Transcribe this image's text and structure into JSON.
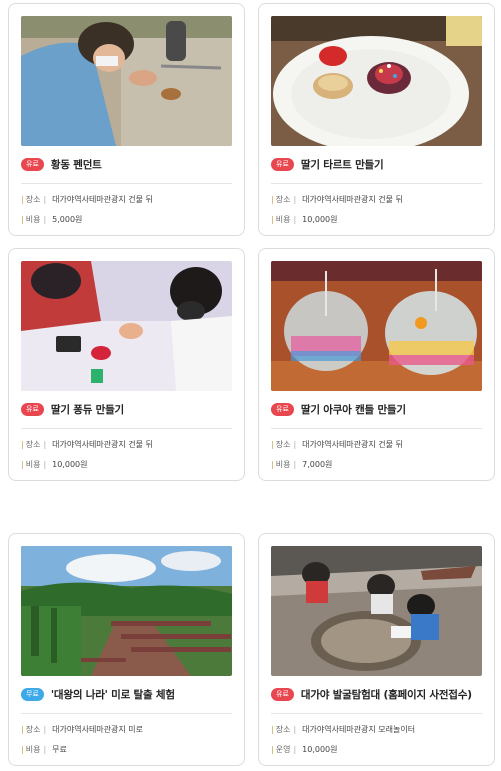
{
  "programs": [
    {
      "badge": "유료",
      "badge_type": "paid",
      "title": "황동 펜던트",
      "info": [
        {
          "label": "장소",
          "value": "대가야역사테마관광지 건물 뒤"
        },
        {
          "label": "비용",
          "value": "5,000원"
        }
      ]
    },
    {
      "badge": "유료",
      "badge_type": "paid",
      "title": "딸기 타르트 만들기",
      "info": [
        {
          "label": "장소",
          "value": "대가야역사테마관광지 건물 뒤"
        },
        {
          "label": "비용",
          "value": "10,000원"
        }
      ]
    },
    {
      "badge": "유료",
      "badge_type": "paid",
      "title": "딸기 퐁듀 만들기",
      "info": [
        {
          "label": "장소",
          "value": "대가야역사테마관광지 건물 뒤"
        },
        {
          "label": "비용",
          "value": "10,000원"
        }
      ]
    },
    {
      "badge": "유료",
      "badge_type": "paid",
      "title": "딸기 아쿠아 캔들 만들기",
      "info": [
        {
          "label": "장소",
          "value": "대가야역사테마관광지 건물 뒤"
        },
        {
          "label": "비용",
          "value": "7,000원"
        }
      ]
    },
    {
      "badge": "무료",
      "badge_type": "free",
      "title": "'대왕의 나라' 미로 탈출 체험",
      "info": [
        {
          "label": "장소",
          "value": "대가야역사테마관광지 미로"
        },
        {
          "label": "비용",
          "value": "무료"
        }
      ]
    },
    {
      "badge": "유료",
      "badge_type": "paid",
      "title": "대가야 발굴탐험대 (홈페이지 사전접수)",
      "info": [
        {
          "label": "장소",
          "value": "대가야역사테마관광지 모래놀이터"
        },
        {
          "label": "운영",
          "value": "10,000원"
        }
      ]
    }
  ],
  "colors": {
    "paid_badge": "#e8474f",
    "free_badge": "#3da9e8",
    "label_bar": "#c9a44a"
  }
}
